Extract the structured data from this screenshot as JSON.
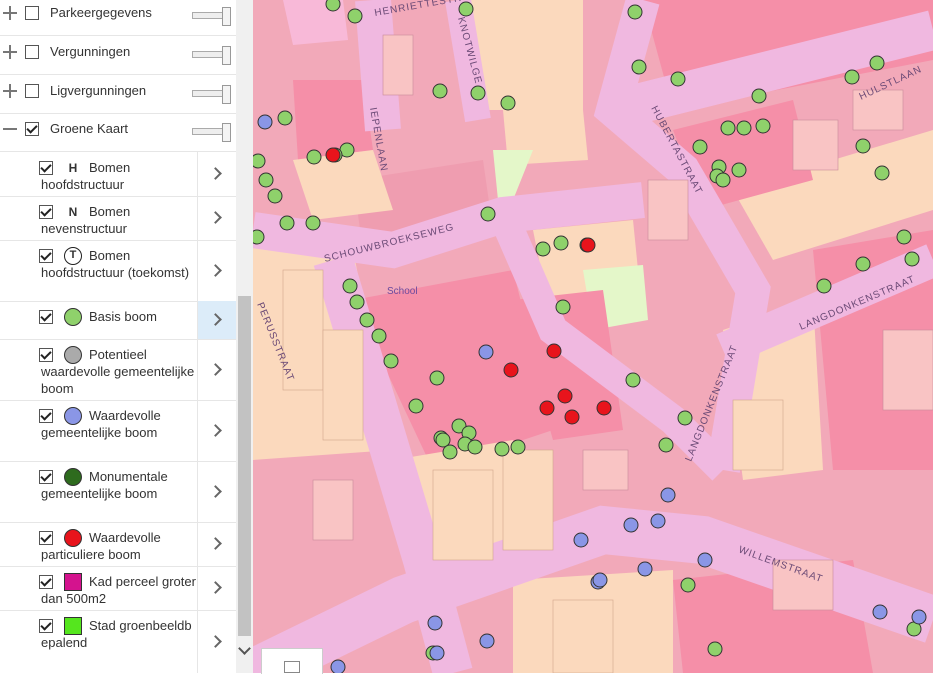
{
  "layers": [
    {
      "label": "Parkeergegevens",
      "checked": false,
      "expanded": false
    },
    {
      "label": "Vergunningen",
      "checked": false,
      "expanded": false
    },
    {
      "label": "Ligvergunningen",
      "checked": false,
      "expanded": false
    },
    {
      "label": "Groene Kaart",
      "checked": true,
      "expanded": true
    }
  ],
  "legend": [
    {
      "label": "Bomen hoofdstructuur",
      "symbol": "H",
      "symbol_type": "letter"
    },
    {
      "label": "Bomen nevenstructuur",
      "symbol": "N",
      "symbol_type": "letter"
    },
    {
      "label": "Bomen hoofdstructuur (toekomst)",
      "symbol": "T",
      "symbol_type": "circle-letter"
    },
    {
      "label": "Basis boom",
      "symbol_type": "dot",
      "color": "#8fd16b"
    },
    {
      "label": "Potentieel waardevolle gemeentelijke boom",
      "symbol_type": "dot",
      "color": "#aaaaaa"
    },
    {
      "label": "Waardevolle gemeentelijke boom",
      "symbol_type": "dot",
      "color": "#8a96e6"
    },
    {
      "label": "Monumentale gemeentelijke boom",
      "symbol_type": "dot",
      "color": "#2e6b1e"
    },
    {
      "label": "Waardevolle particuliere boom",
      "symbol_type": "dot",
      "color": "#e8141c"
    },
    {
      "label": "Kad perceel groter dan 500m2",
      "symbol_type": "square",
      "color": "#d4138e"
    },
    {
      "label": "Stad groenbeeldbepalend",
      "symbol_type": "square",
      "color": "#55e61e"
    }
  ],
  "map": {
    "streets": [
      "HENRIETTESTR",
      "KNOTWILGE",
      "IEPENLAAN",
      "HUBERTASTRAAT",
      "HULSTLAAN",
      "SCHOUWBROEKSEWEG",
      "LANGDONKENSTRAAT",
      "LANGDONKENSTRAAT",
      "PERUSSTRAAT",
      "WILLEMSTRAAT"
    ],
    "labels": {
      "school": "School"
    },
    "colors": {
      "green_tree": "#8fd16b",
      "blue_tree": "#8a96e6",
      "red_tree": "#e8141c",
      "road": "#f0b8e0",
      "parcel": "#f2a9b9",
      "building": "#fbd9bd"
    }
  },
  "icons": {
    "expand": "plus-icon",
    "collapse": "minus-icon",
    "chevron": "chevron-right-icon",
    "scroll": "chevron-down-icon",
    "map_toggle": "image-icon"
  }
}
